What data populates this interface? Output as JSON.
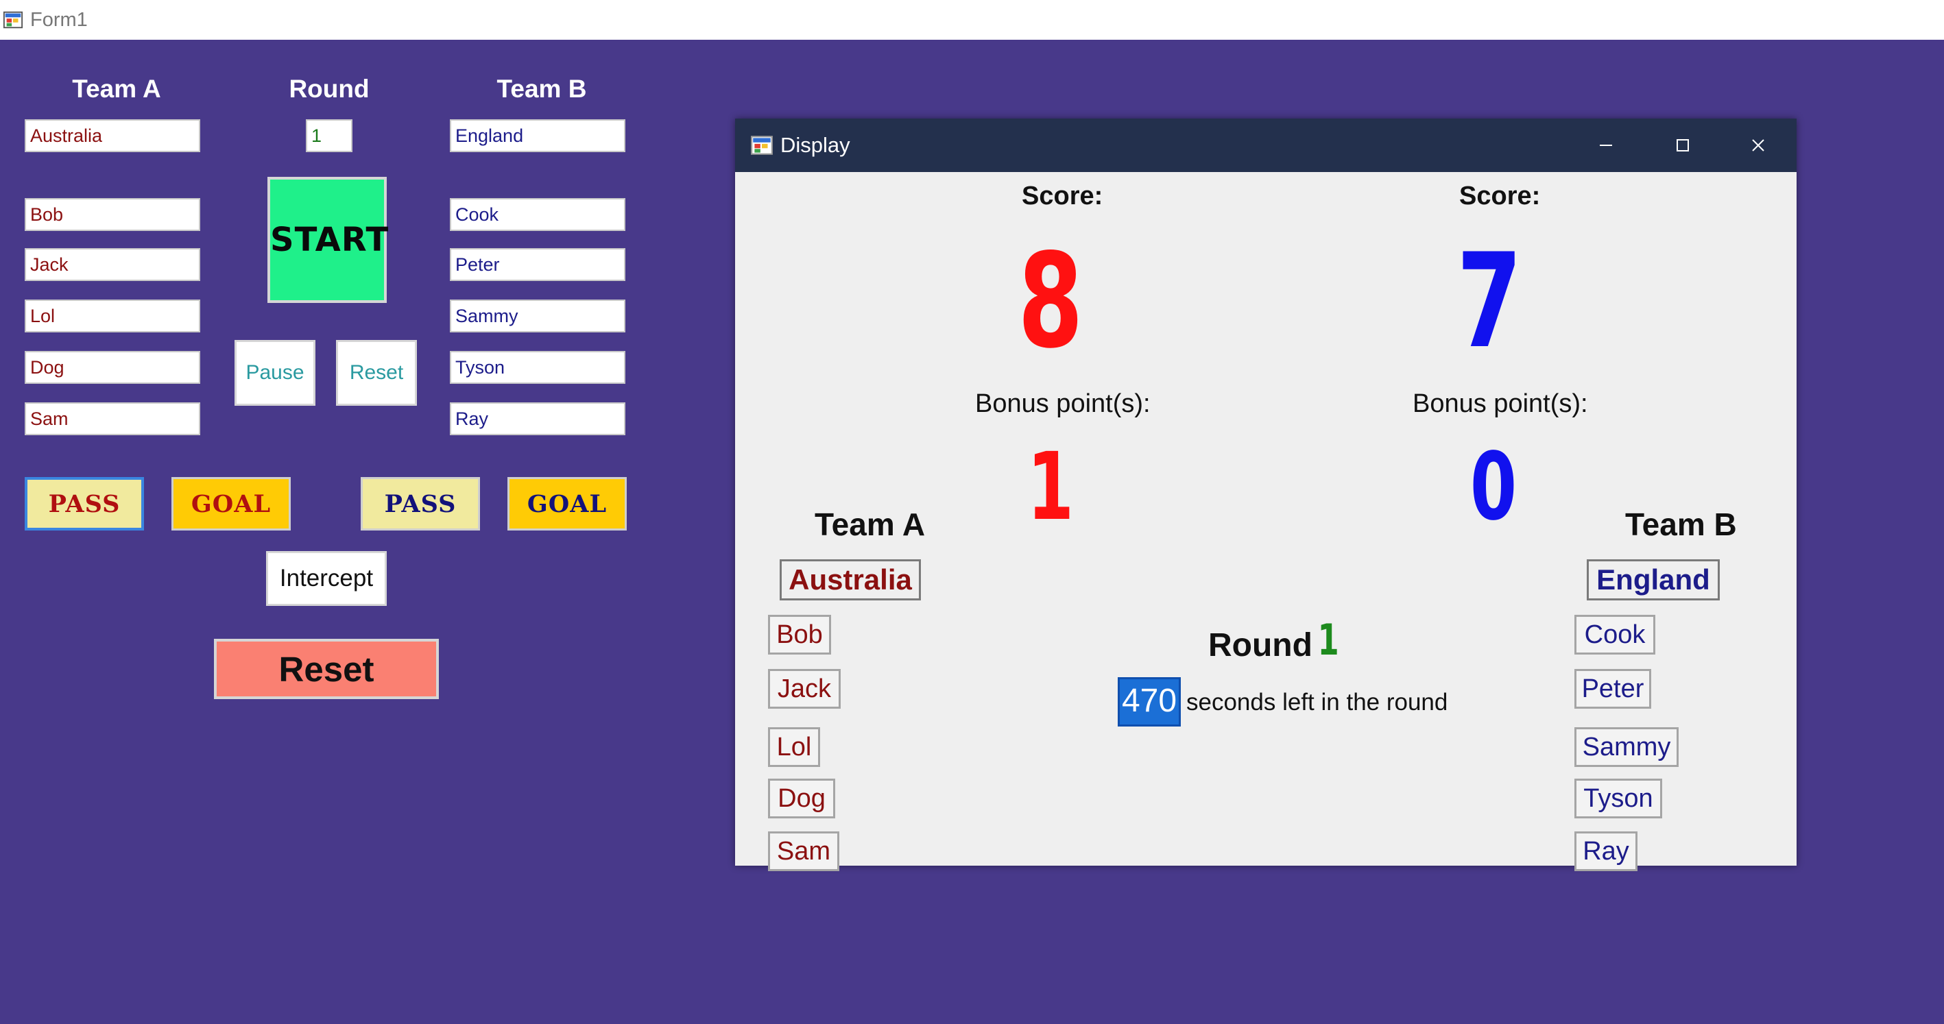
{
  "form1": {
    "title": "Form1",
    "team_a_header": "Team A",
    "round_header": "Round",
    "team_b_header": "Team B",
    "team_a_name": "Australia",
    "round_value": "1",
    "team_b_name": "England",
    "team_a_players": [
      "Bob",
      "Jack",
      "Lol",
      "Dog",
      "Sam"
    ],
    "team_b_players": [
      "Cook",
      "Peter",
      "Sammy",
      "Tyson",
      "Ray"
    ],
    "start_label": "START",
    "pause_label": "Pause",
    "reset_small_label": "Reset",
    "pass_label": "PASS",
    "goal_label": "GOAL",
    "intercept_label": "Intercept",
    "reset_label": "Reset"
  },
  "display": {
    "title": "Display",
    "score_label": "Score:",
    "bonus_label": "Bonus point(s):",
    "team_a_score": "8",
    "team_b_score": "7",
    "team_a_bonus": "1",
    "team_b_bonus": "0",
    "team_a_header": "Team A",
    "team_b_header": "Team B",
    "team_a_name": "Australia",
    "team_b_name": "England",
    "team_a_players": [
      "Bob",
      "Jack",
      "Lol",
      "Dog",
      "Sam"
    ],
    "team_b_players": [
      "Cook",
      "Peter",
      "Sammy",
      "Tyson",
      "Ray"
    ],
    "round_label": "Round",
    "round_value": "1",
    "seconds_value": "470",
    "seconds_text": "seconds left in the round"
  },
  "colors": {
    "background": "#48398a",
    "team_a": "#ff1111",
    "team_b": "#1111ee",
    "start": "#1ff08a",
    "goal": "#ffcb05",
    "pass": "#f1ea9e",
    "reset": "#fa8072",
    "round_number": "#1d8a1d"
  },
  "icons": {
    "app": "winforms-app-icon",
    "minimize": "minimize-icon",
    "maximize": "maximize-icon",
    "close": "close-icon"
  }
}
